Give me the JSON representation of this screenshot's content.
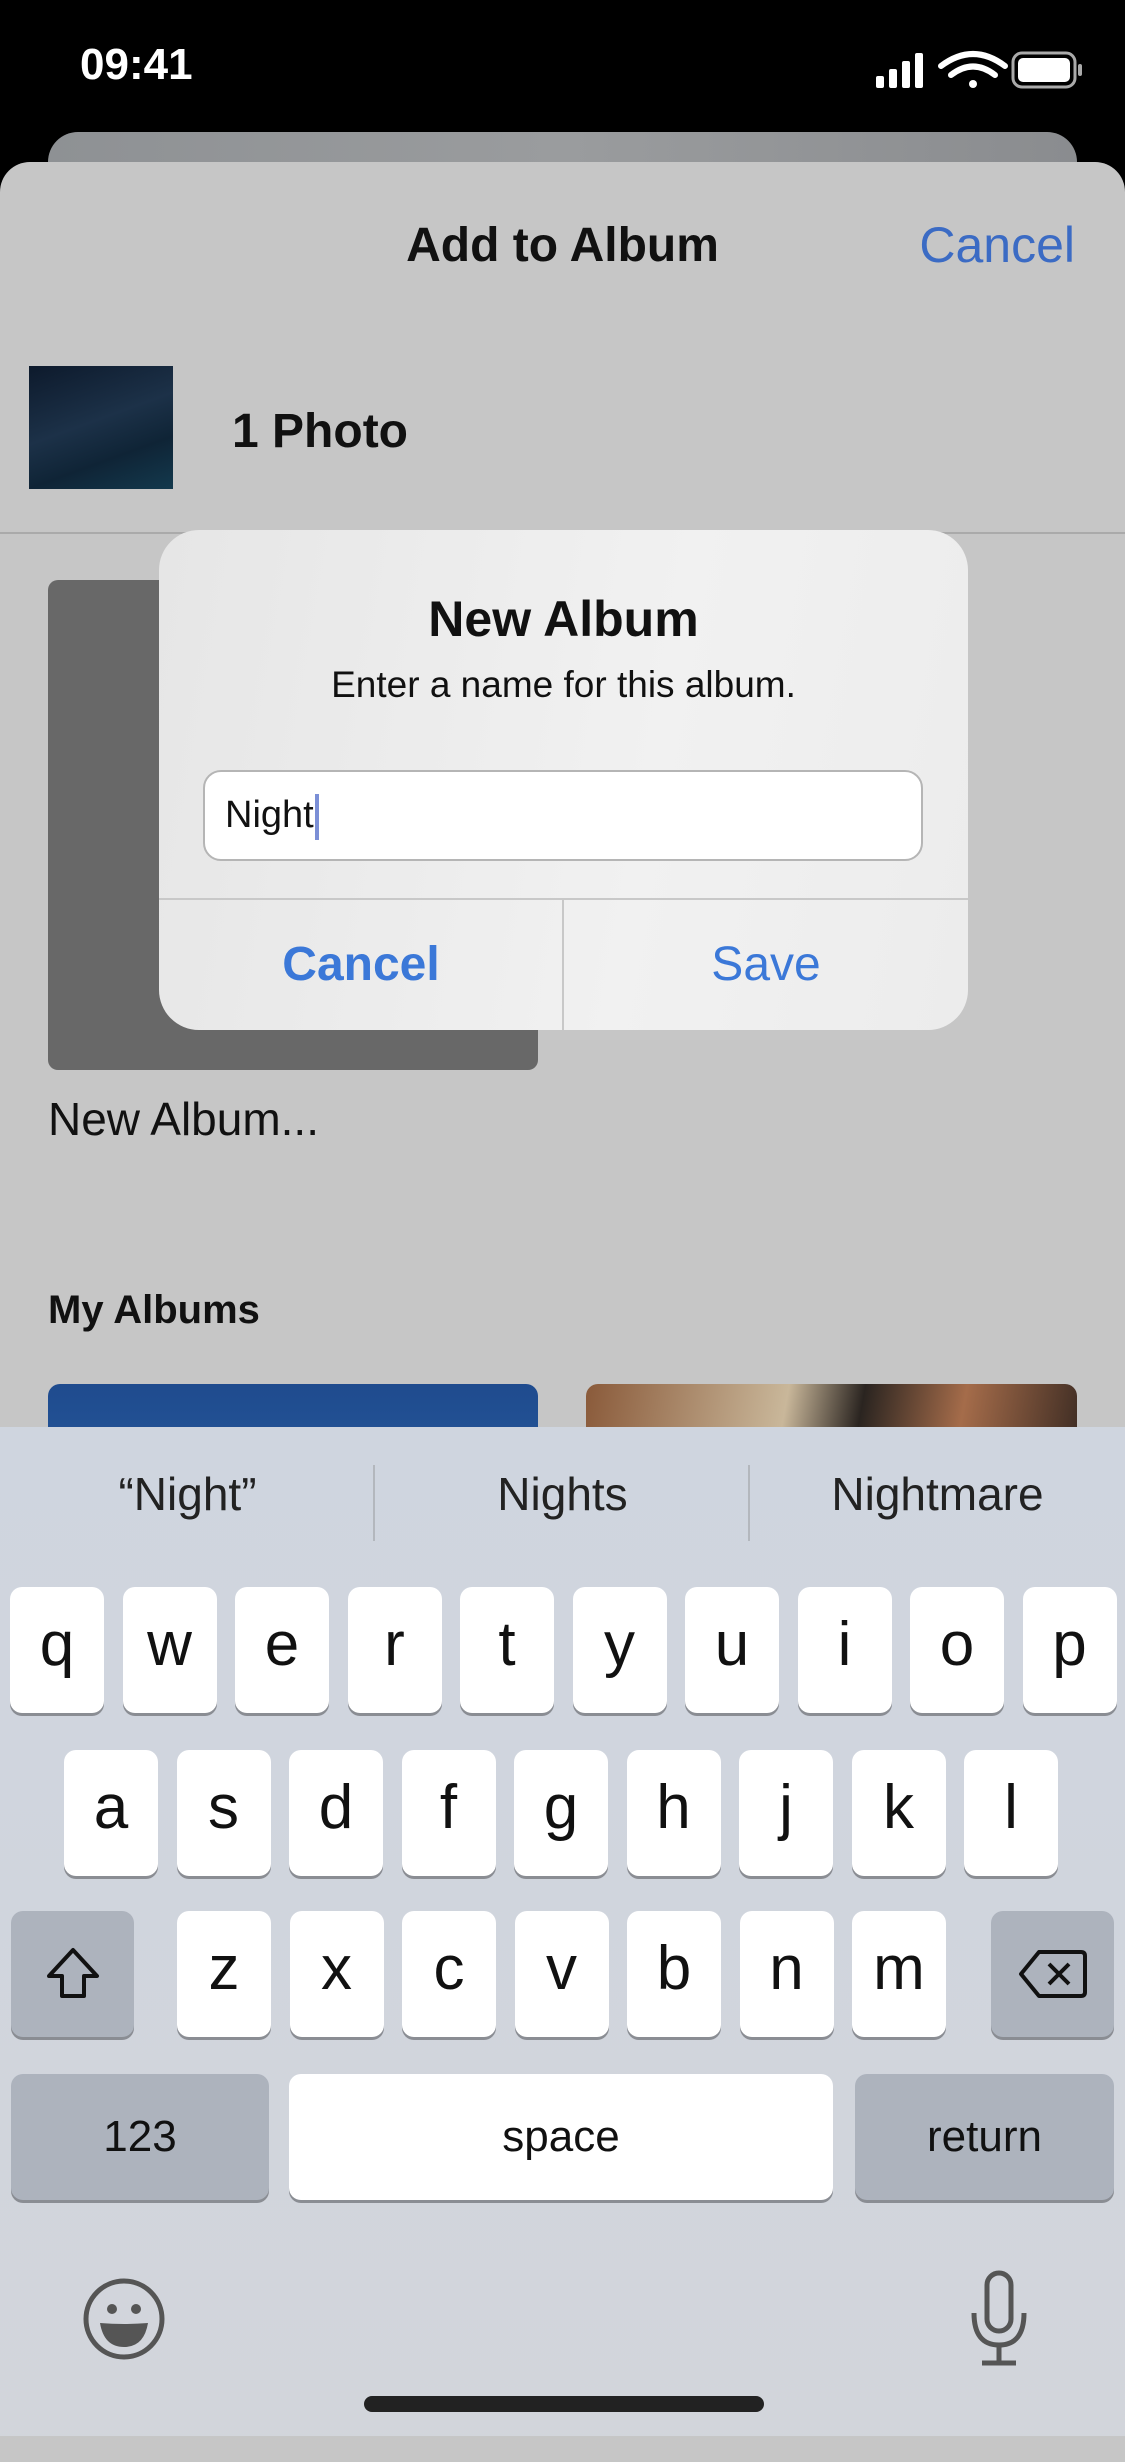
{
  "status_bar": {
    "time": "09:41",
    "icons": [
      "signal-icon",
      "wifi-icon",
      "battery-icon"
    ]
  },
  "sheet": {
    "title": "Add to Album",
    "cancel_label": "Cancel",
    "photo_count": "1 Photo",
    "new_album_label": "New Album...",
    "section_title": "My Albums"
  },
  "alert": {
    "title": "New Album",
    "message": "Enter a name for this album.",
    "input_value": "Night",
    "cancel_label": "Cancel",
    "save_label": "Save"
  },
  "keyboard": {
    "suggestions": [
      "“Night”",
      "Nights",
      "Nightmare"
    ],
    "row1": [
      "q",
      "w",
      "e",
      "r",
      "t",
      "y",
      "u",
      "i",
      "o",
      "p"
    ],
    "row2": [
      "a",
      "s",
      "d",
      "f",
      "g",
      "h",
      "j",
      "k",
      "l"
    ],
    "row3": [
      "z",
      "x",
      "c",
      "v",
      "b",
      "n",
      "m"
    ],
    "numbers_label": "123",
    "space_label": "space",
    "return_label": "return"
  },
  "colors": {
    "accent": "#3b78d8",
    "sheet_bg": "#c6c6c6",
    "keyboard_bg": "#d1d5db"
  }
}
